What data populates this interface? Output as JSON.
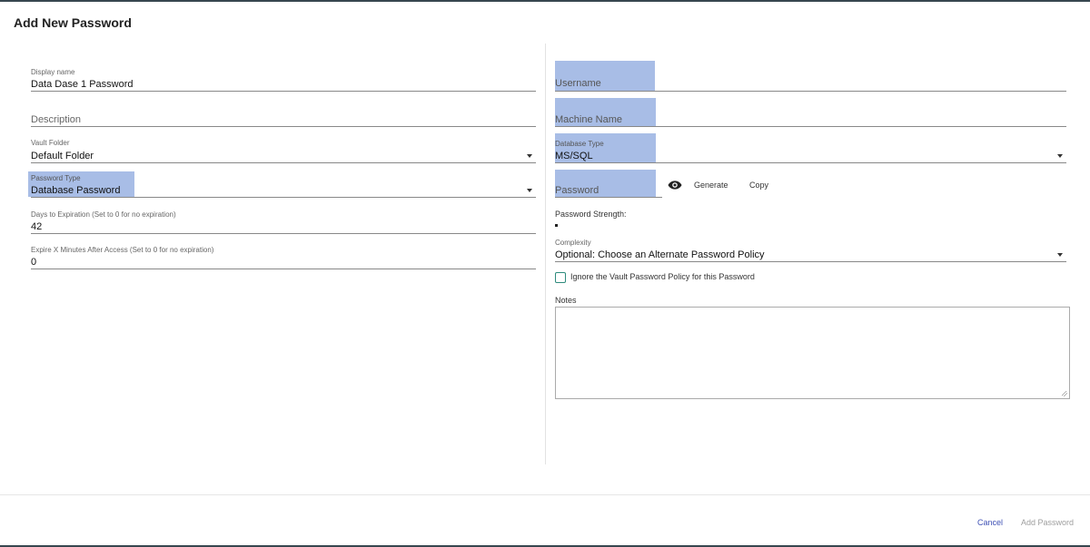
{
  "dialog": {
    "title": "Add New Password"
  },
  "left": {
    "display_name": {
      "label": "Display name",
      "value": "Data Dase 1 Password"
    },
    "description": {
      "placeholder": "Description"
    },
    "vault_folder": {
      "label": "Vault Folder",
      "value": "Default Folder"
    },
    "password_type": {
      "label": "Password Type",
      "value": "Database Password"
    },
    "days_to_expiration": {
      "label": "Days to Expiration (Set to 0 for no expiration)",
      "value": "42"
    },
    "expire_minutes": {
      "label": "Expire X Minutes After Access (Set to 0 for no expiration)",
      "value": "0"
    }
  },
  "right": {
    "username": {
      "placeholder": "Username"
    },
    "machine_name": {
      "placeholder": "Machine Name"
    },
    "database_type": {
      "label": "Database Type",
      "value": "MS/SQL"
    },
    "password": {
      "placeholder": "Password"
    },
    "generate_label": "Generate",
    "copy_label": "Copy",
    "password_strength_label": "Password Strength:",
    "complexity": {
      "label": "Complexity",
      "value": "Optional: Choose an Alternate Password Policy"
    },
    "ignore_policy_label": "Ignore the Vault Password Policy for this Password",
    "notes_label": "Notes"
  },
  "footer": {
    "cancel_label": "Cancel",
    "add_label": "Add Password"
  },
  "colors": {
    "highlight": "#a8bde6",
    "cancel": "#3f51b5",
    "disabled": "#9e9e9e",
    "checkbox_border": "#2e8b7d",
    "header_bar": "#37474f"
  },
  "icons": {
    "eye": "eye-icon",
    "dropdown": "chevron-down-icon"
  }
}
